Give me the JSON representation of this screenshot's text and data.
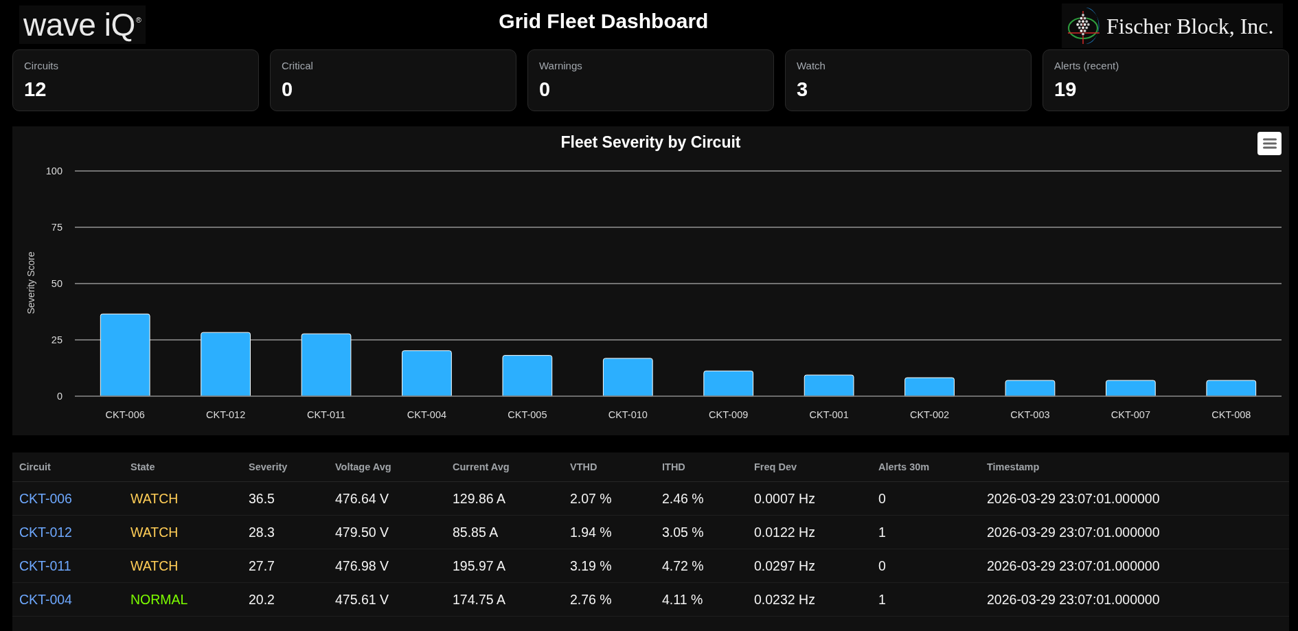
{
  "header": {
    "logo": "wave iQ$^{®}$",
    "title": "Grid Fleet Dashboard",
    "company": "Fischer Block, Inc."
  },
  "kpis": [
    {
      "label": "Circuits",
      "value": "12"
    },
    {
      "label": "Critical",
      "value": "0"
    },
    {
      "label": "Warnings",
      "value": "0"
    },
    {
      "label": "Watch",
      "value": "3"
    },
    {
      "label": "Alerts (recent)",
      "value": "19"
    }
  ],
  "severity_chart": {
    "chart_data": {
      "type": "bar",
      "title": "Fleet Severity by Circuit",
      "ylabel": "Severity Score",
      "categories": [
        "CKT-006",
        "CKT-012",
        "CKT-011",
        "CKT-004",
        "CKT-005",
        "CKT-010",
        "CKT-009",
        "CKT-001",
        "CKT-002",
        "CKT-003",
        "CKT-007",
        "CKT-008"
      ],
      "series": [
        {
          "color": "#2caffe",
          "values": [
            36.5,
            28.3,
            27.7,
            20.2,
            18.1,
            16.8,
            11.2,
            9.4,
            8.2,
            7.0,
            7.0,
            7.0
          ]
        }
      ],
      "ylim": [
        0,
        100
      ],
      "yticks": [
        0,
        25,
        50,
        75,
        100
      ],
      "grid": true
    }
  },
  "table": {
    "columns": [
      {
        "label": "Circuit",
        "kind": "link"
      },
      {
        "label": "State",
        "kind": "status"
      },
      {
        "label": "Severity",
        "kind": "text"
      },
      {
        "label": "Voltage Avg",
        "kind": "text"
      },
      {
        "label": "Current Avg",
        "kind": "text"
      },
      {
        "label": "VTHD",
        "kind": "text"
      },
      {
        "label": "ITHD",
        "kind": "text"
      },
      {
        "label": "Freq Dev",
        "kind": "text"
      },
      {
        "label": "Alerts 30m",
        "kind": "text"
      },
      {
        "label": "Timestamp",
        "kind": "text"
      }
    ],
    "rows": [
      {
        "cells": [
          {
            "text": "CKT-006"
          },
          {
            "text": "WATCH",
            "color": "#ffcd57"
          },
          {
            "text": "36.5"
          },
          {
            "text": "476.64 V"
          },
          {
            "text": "129.86 A"
          },
          {
            "text": "2.07 %"
          },
          {
            "text": "2.46 %"
          },
          {
            "text": "0.0007 Hz"
          },
          {
            "text": "0"
          },
          {
            "text": "2026-03-29 23:07:01.000000"
          }
        ]
      },
      {
        "cells": [
          {
            "text": "CKT-012"
          },
          {
            "text": "WATCH",
            "color": "#ffcd57"
          },
          {
            "text": "28.3"
          },
          {
            "text": "479.50 V"
          },
          {
            "text": "85.85 A"
          },
          {
            "text": "1.94 %"
          },
          {
            "text": "3.05 %"
          },
          {
            "text": "0.0122 Hz"
          },
          {
            "text": "1"
          },
          {
            "text": "2026-03-29 23:07:01.000000"
          }
        ]
      },
      {
        "cells": [
          {
            "text": "CKT-011"
          },
          {
            "text": "WATCH",
            "color": "#ffcd57"
          },
          {
            "text": "27.7"
          },
          {
            "text": "476.98 V"
          },
          {
            "text": "195.97 A"
          },
          {
            "text": "3.19 %"
          },
          {
            "text": "4.72 %"
          },
          {
            "text": "0.0297 Hz"
          },
          {
            "text": "0"
          },
          {
            "text": "2026-03-29 23:07:01.000000"
          }
        ]
      },
      {
        "cells": [
          {
            "text": "CKT-004"
          },
          {
            "text": "NORMAL",
            "color": "#7cfc00"
          },
          {
            "text": "20.2"
          },
          {
            "text": "475.61 V"
          },
          {
            "text": "174.75 A"
          },
          {
            "text": "2.76 %"
          },
          {
            "text": "4.11 %"
          },
          {
            "text": "0.0232 Hz"
          },
          {
            "text": "1"
          },
          {
            "text": "2026-03-29 23:07:01.000000"
          }
        ]
      }
    ]
  }
}
